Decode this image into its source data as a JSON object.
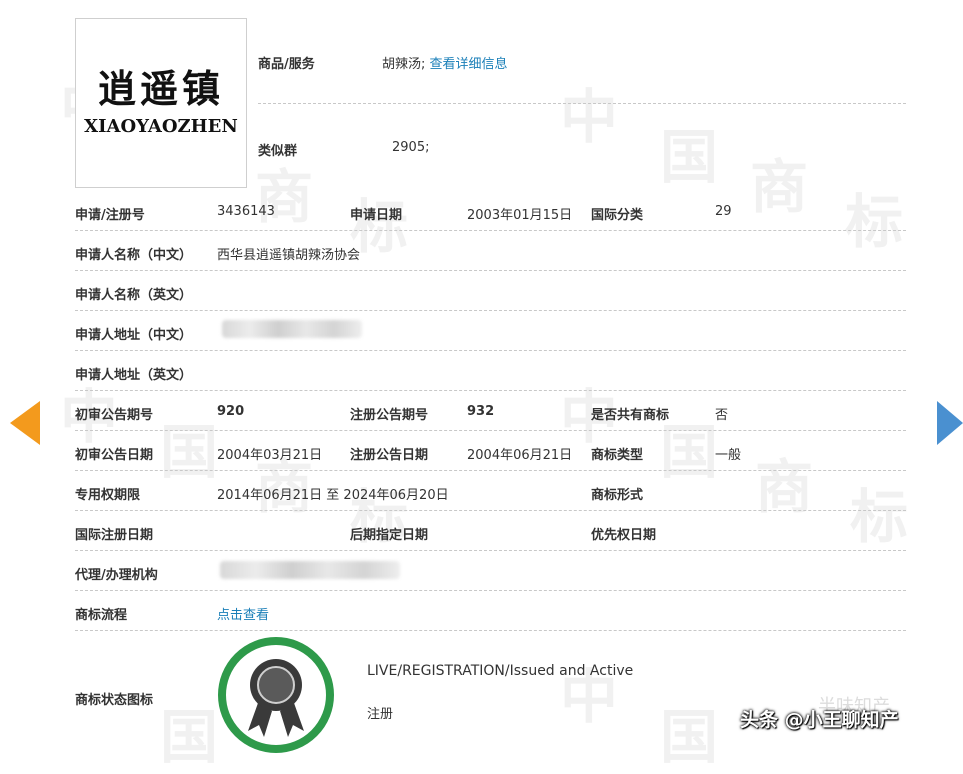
{
  "watermark": {
    "chars": [
      "中",
      "国",
      "商",
      "标"
    ]
  },
  "logo": {
    "cn": "逍遥镇",
    "en": "XIAOYAOZHEN"
  },
  "goods": {
    "label": "商品/服务",
    "value": "胡辣汤;",
    "link": "查看详细信息"
  },
  "similar": {
    "label": "类似群",
    "value": "2905;"
  },
  "rows": {
    "reg_no_label": "申请/注册号",
    "reg_no": "3436143",
    "apply_date_label": "申请日期",
    "apply_date": "2003年01月15日",
    "intl_class_label": "国际分类",
    "intl_class": "29",
    "applicant_cn_label": "申请人名称（中文）",
    "applicant_cn": "西华县逍遥镇胡辣汤协会",
    "applicant_en_label": "申请人名称（英文）",
    "address_cn_label": "申请人地址（中文）",
    "address_en_label": "申请人地址（英文）",
    "prelim_no_label": "初审公告期号",
    "prelim_no": "920",
    "reg_pub_no_label": "注册公告期号",
    "reg_pub_no": "932",
    "shared_label": "是否共有商标",
    "shared": "否",
    "prelim_date_label": "初审公告日期",
    "prelim_date": "2004年03月21日",
    "reg_pub_date_label": "注册公告日期",
    "reg_pub_date": "2004年06月21日",
    "mark_type_label": "商标类型",
    "mark_type": "一般",
    "exclusive_label": "专用权期限",
    "exclusive": "2014年06月21日 至 2024年06月20日",
    "mark_form_label": "商标形式",
    "intl_reg_date_label": "国际注册日期",
    "later_desig_label": "后期指定日期",
    "priority_label": "优先权日期",
    "agent_label": "代理/办理机构",
    "process_label": "商标流程",
    "process_link": "点击查看",
    "status_icon_label": "商标状态图标",
    "status_en": "LIVE/REGISTRATION/Issued and Active",
    "status_cn": "注册"
  },
  "footer": {
    "text": "头条 @小王聊知产",
    "ghost": "半味知产"
  },
  "colors": {
    "link": "#1a7fb8",
    "badge_green": "#2e9a4a",
    "arrow_left": "#f39a1d",
    "arrow_right": "#4a90d0"
  }
}
